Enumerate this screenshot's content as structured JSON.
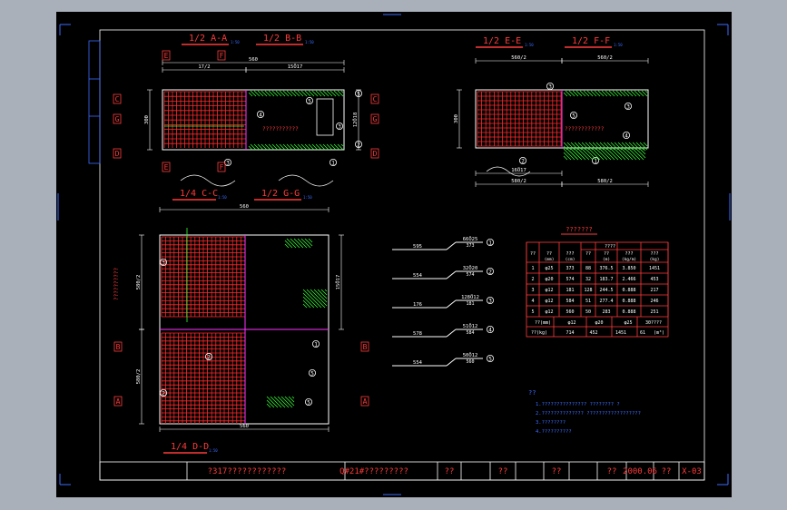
{
  "section_titles": {
    "aa": "1/2  A-A",
    "bb": "1/2  B-B",
    "ee": "1/2  E-E",
    "ff": "1/2  F-F",
    "cc": "1/4  C-C",
    "gg": "1/2  G-G",
    "dd": "1/4  D-D"
  },
  "title_block": {
    "drawing_title": "?317????????????",
    "subtitle": "Q#21#?????????",
    "cells": [
      "??",
      "??",
      "??",
      "??"
    ],
    "date": "2000.06",
    "cell_after_date": "??",
    "sheet_no": "X-03"
  },
  "bar_schedule": {
    "title": "???????",
    "header_top": "????",
    "col_headers": [
      "??",
      "??\n(mm)",
      "???\n(cm)",
      "??",
      "??\n(m)",
      "???\n(kg/m)",
      "???\n(kg)"
    ],
    "rows": [
      [
        "1",
        "φ25",
        "373",
        "88",
        "376.5",
        "3.850",
        "1451"
      ],
      [
        "2",
        "φ20",
        "574",
        "32",
        "183.7",
        "2.466",
        "453"
      ],
      [
        "3",
        "φ12",
        "181",
        "128",
        "244.5",
        "0.888",
        "217"
      ],
      [
        "4",
        "φ12",
        "584",
        "51",
        "277.4",
        "0.888",
        "246"
      ],
      [
        "5",
        "φ12",
        "560",
        "50",
        "283",
        "0.888",
        "251"
      ]
    ],
    "sum_row1": [
      "??(mm)",
      "φ12",
      "φ20",
      "φ25",
      "30????"
    ],
    "sum_row2": [
      "??(kg)",
      "714",
      "452",
      "1451",
      "61",
      "(m³)"
    ]
  },
  "notes": {
    "heading": "??",
    "lines": [
      "1.??????????????? ????????     ?",
      "2.?????????????? ??????????????????",
      "3.????????",
      "4.??????????"
    ]
  },
  "bar_details": [
    {
      "len": "595",
      "tag": "66Ö25",
      "sub": "373",
      "mark": "1"
    },
    {
      "len": "554",
      "tag": "32Ö20",
      "sub": "574",
      "mark": "2"
    },
    {
      "len": "176",
      "tag": "128Ö12",
      "sub": "181",
      "mark": "3"
    },
    {
      "len": "578",
      "tag": "51Ö12",
      "sub": "584",
      "mark": "4"
    },
    {
      "len": "554",
      "tag": "50Ö12",
      "sub": "560",
      "mark": "5"
    }
  ],
  "dims": {
    "top_total": "560",
    "half": "560/2",
    "half2": "580/2",
    "half3": "580/2",
    "sub1": "17/2",
    "sub2": "28.4/2",
    "count1": "15Ö17",
    "count2": "16Ö17",
    "sm1": "4.8",
    "sm2": "6.5",
    "sm3": "10.8",
    "sm4": "6.2",
    "h1": "300",
    "h2": "12Ö18",
    "bottom": "6.5/2",
    "pl1": "???????????",
    "pl2": "????????????",
    "pl3": "??????????"
  },
  "colors": {
    "background": "#000000",
    "grid_red": "#ff2a2a",
    "outline_white": "#ffffff",
    "dim_green": "#33ff33",
    "magenta": "#ff33ff",
    "frame_blue": "#3b6cff",
    "title_red": "#ff3b3b"
  }
}
